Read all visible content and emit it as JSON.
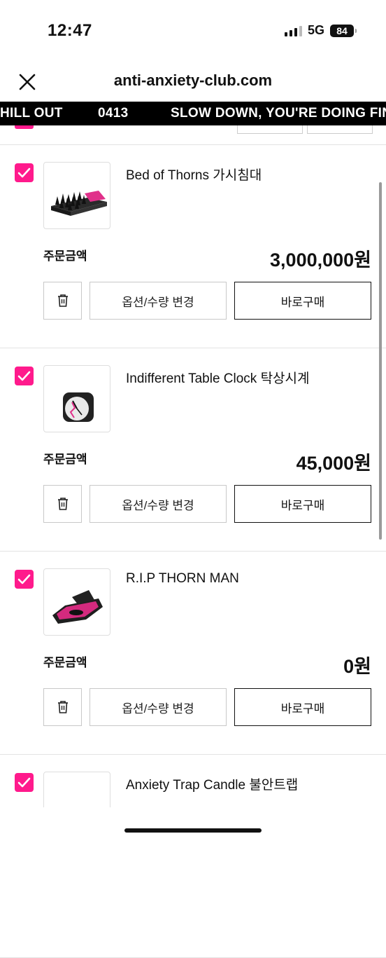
{
  "status_bar": {
    "time": "12:47",
    "network": "5G",
    "battery": "84"
  },
  "header": {
    "site_title": "anti-anxiety-club.com"
  },
  "marquee": {
    "items": [
      "HILL OUT",
      "0413",
      "SLOW DOWN, YOU'RE DOING FIN"
    ]
  },
  "cart": {
    "amount_label": "주문금액",
    "option_button": "옵션/수량 변경",
    "buy_button": "바로구매",
    "items": [
      {
        "name": "Bed of Thorns 가시침대",
        "price": "3,000,000원",
        "checked": true,
        "thumb_icon": "bed-of-thorns-image"
      },
      {
        "name": "Indifferent Table Clock 탁상시계",
        "price": "45,000원",
        "checked": true,
        "thumb_icon": "table-clock-image"
      },
      {
        "name": "R.I.P THORN MAN",
        "price": "0원",
        "checked": true,
        "thumb_icon": "coffin-image"
      },
      {
        "name": "Anxiety Trap Candle 불안트랩",
        "price": "",
        "checked": true,
        "thumb_icon": "candle-image"
      }
    ]
  },
  "colors": {
    "accent": "#ff1a8c",
    "marquee_bg": "#000000"
  }
}
